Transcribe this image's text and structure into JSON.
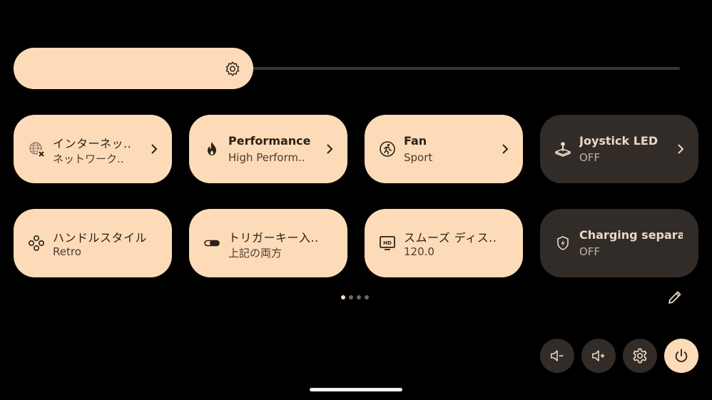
{
  "brightness": {
    "level": 0.33,
    "icon": "brightness-icon"
  },
  "tiles": [
    {
      "label": "インターネッ..",
      "sub": "ネットワーク..",
      "icon": "globe-off-icon",
      "state": "on",
      "chevron": true
    },
    {
      "label": "Performance",
      "sub": "High Perform..",
      "icon": "flame-icon",
      "state": "on",
      "chevron": true
    },
    {
      "label": "Fan",
      "sub": "Sport",
      "icon": "fan-running-icon",
      "state": "on",
      "chevron": true
    },
    {
      "label": "Joystick LED",
      "sub": "OFF",
      "icon": "joystick-icon",
      "state": "off",
      "chevron": true
    },
    {
      "label": "ハンドルスタイル",
      "sub": "Retro",
      "icon": "gamepad-buttons-icon",
      "state": "on",
      "chevron": false
    },
    {
      "label": "トリガーキー入..",
      "sub": "上記の両方",
      "icon": "trigger-key-icon",
      "state": "on",
      "chevron": false
    },
    {
      "label": "スムーズ ディス..",
      "sub": "120.0",
      "icon": "hd-display-icon",
      "state": "on",
      "chevron": false
    },
    {
      "label": "Charging separat..",
      "sub": "OFF",
      "icon": "battery-shield-icon",
      "state": "off",
      "chevron": false
    }
  ],
  "pager": {
    "pages": 4,
    "current": 1
  },
  "colors": {
    "tile_on": "#fedbb8",
    "tile_off": "#322c28",
    "background": "#000000"
  },
  "bottom_buttons": [
    {
      "name": "volume-down-button",
      "icon": "volume-down-icon"
    },
    {
      "name": "volume-up-button",
      "icon": "volume-up-icon"
    },
    {
      "name": "settings-button",
      "icon": "gear-icon"
    },
    {
      "name": "power-button",
      "icon": "power-icon"
    }
  ]
}
